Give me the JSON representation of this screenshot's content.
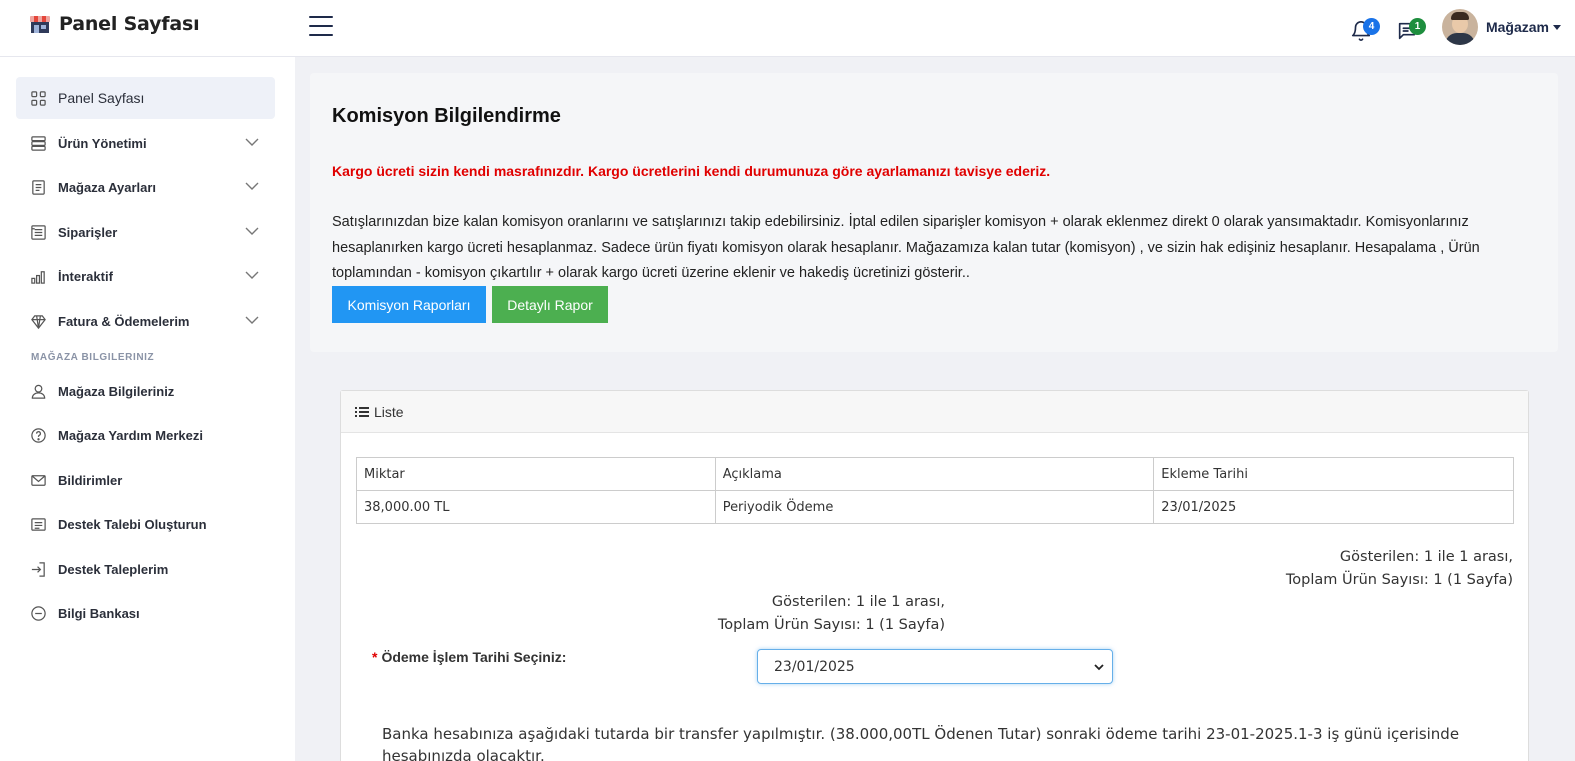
{
  "header": {
    "brand_title": "Panel Sayfası",
    "user_name": "Mağazam",
    "notifications_count": "4",
    "messages_count": "1",
    "colors": {
      "accent": "#1a73e8",
      "messages_badge": "#1e8e3e"
    }
  },
  "sidebar": {
    "items": [
      {
        "label": "Panel Sayfası",
        "icon": "grid-icon",
        "active": true
      },
      {
        "label": "Ürün Yönetimi",
        "icon": "server-icon",
        "has_submenu": true
      },
      {
        "label": "Mağaza Ayarları",
        "icon": "document-icon",
        "has_submenu": true
      },
      {
        "label": "Siparişler",
        "icon": "list-icon",
        "has_submenu": true
      },
      {
        "label": "İnteraktif",
        "icon": "bar-chart-icon",
        "has_submenu": true
      },
      {
        "label": "Fatura & Ödemelerim",
        "icon": "diamond-icon",
        "has_submenu": true
      }
    ],
    "section_title": "MAĞAZA BILGILERINIZ",
    "section_items": [
      {
        "label": "Mağaza Bilgileriniz",
        "icon": "user-icon"
      },
      {
        "label": "Mağaza Yardım Merkezi",
        "icon": "help-circle-icon"
      },
      {
        "label": "Bildirimler",
        "icon": "mail-icon"
      },
      {
        "label": "Destek Talebi Oluşturun",
        "icon": "list-alt-icon"
      },
      {
        "label": "Destek Taleplerim",
        "icon": "login-icon"
      },
      {
        "label": "Bilgi Bankası",
        "icon": "more-circle-icon"
      }
    ]
  },
  "info": {
    "title": "Komisyon Bilgilendirme",
    "warning": "Kargo ücreti sizin kendi masrafınızdır. Kargo ücretlerini kendi durumunuza göre ayarlamanızı tavisye ederiz.",
    "description": "Satışlarınızdan bize kalan komisyon oranlarını ve satışlarınızı takip edebilirsiniz. İptal edilen siparişler komisyon + olarak eklenmez direkt 0 olarak yansımaktadır. Komisyonlarınız hesaplanırken kargo ücreti hesaplanmaz. Sadece ürün fiyatı komisyon olarak hesaplanır. Mağazamıza kalan tutar (komisyon) , ve sizin hak edişiniz hesaplanır. Hesapalama , Ürün toplamından - komisyon çıkartılır + olarak kargo ücreti üzerine eklenir ve hakediş ücretinizi gösterir..",
    "button_reports": "Komisyon Raporları",
    "button_detailed": "Detaylı Rapor",
    "colors": {
      "warning": "#e00000",
      "button_reports": "#2196f3",
      "button_detailed": "#4caf50"
    }
  },
  "list": {
    "header": "Liste",
    "columns": [
      "Miktar",
      "Açıklama",
      "Ekleme Tarihi"
    ],
    "rows": [
      [
        "38,000.00 TL",
        "Periyodik Ödeme",
        "23/01/2025"
      ]
    ],
    "summary_shown": "Gösterilen: 1 ile 1 arası,",
    "summary_total": "Toplam Ürün Sayısı: 1 (1 Sayfa)",
    "date_label": "Ödeme İşlem Tarihi Seçiniz:",
    "date_label_required": "*",
    "date_selected": "23/01/2025",
    "bank_note": "Banka hesabınıza aşağıdaki tutarda bir transfer yapılmıştır. (38.000,00TL Ödenen Tutar) sonraki ödeme tarihi 23-01-2025.1-3 iş günü içerisinde hesabınızda olacaktır."
  }
}
